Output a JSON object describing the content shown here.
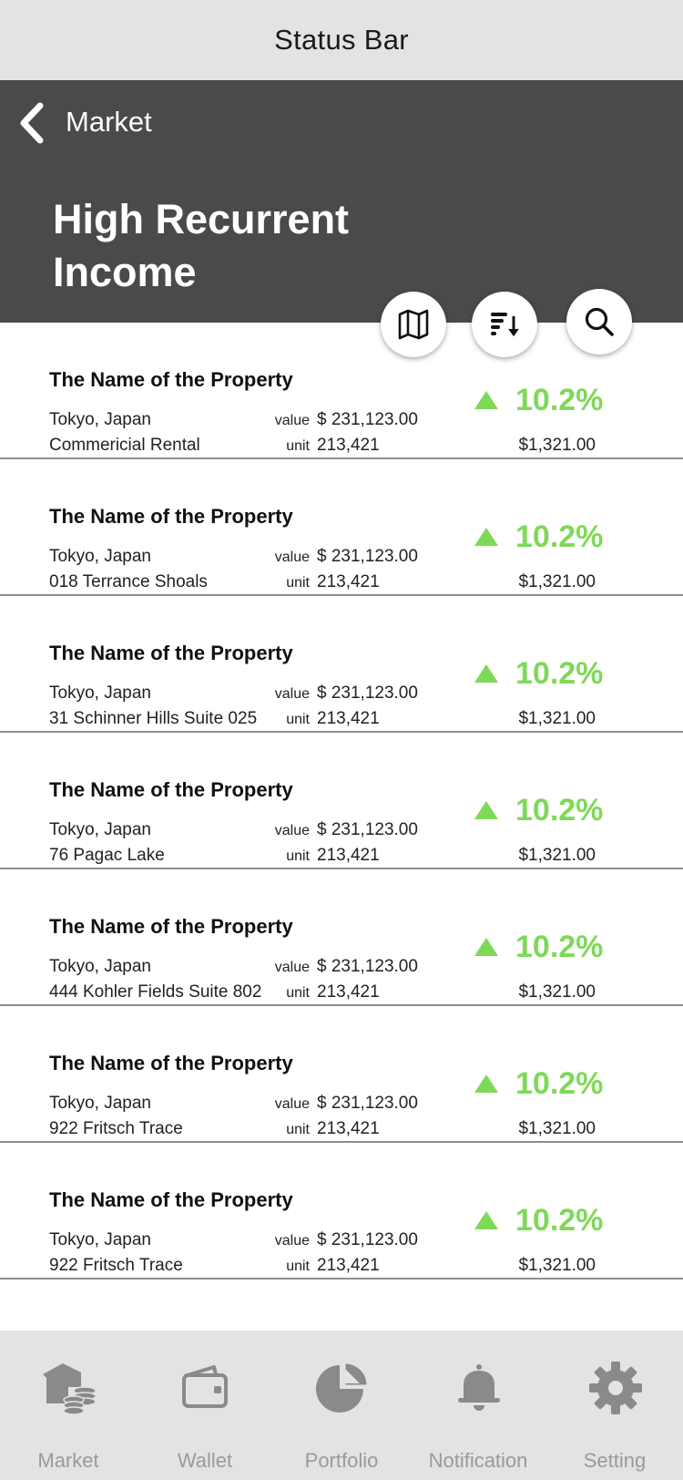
{
  "status_bar": {
    "text": "Status Bar"
  },
  "header": {
    "back_label": "Market",
    "title": "High Recurrent Income"
  },
  "actions": [
    {
      "name": "map",
      "icon": "map-icon"
    },
    {
      "name": "sort",
      "icon": "sort-descending-icon"
    },
    {
      "name": "search",
      "icon": "search-icon"
    }
  ],
  "colors": {
    "header_bg": "#4a4a4a",
    "positive": "#7ed957",
    "tabbar_bg": "#e3e2e5",
    "tab_icon": "#8a8a8a"
  },
  "list": {
    "value_label": "value",
    "unit_label": "unit",
    "items": [
      {
        "name": "The Name of the Property",
        "location": "Tokyo, Japan",
        "address": "Commericial Rental",
        "value": "$ 231,123.00",
        "unit": "213,421",
        "change": "10.2%",
        "price": "$1,321.00"
      },
      {
        "name": "The Name of the Property",
        "location": "Tokyo, Japan",
        "address": "018 Terrance Shoals",
        "value": "$ 231,123.00",
        "unit": "213,421",
        "change": "10.2%",
        "price": "$1,321.00"
      },
      {
        "name": "The Name of the Property",
        "location": "Tokyo, Japan",
        "address": "31 Schinner Hills Suite 025",
        "value": "$ 231,123.00",
        "unit": "213,421",
        "change": "10.2%",
        "price": "$1,321.00"
      },
      {
        "name": "The Name of the Property",
        "location": "Tokyo, Japan",
        "address": "76 Pagac Lake",
        "value": "$ 231,123.00",
        "unit": "213,421",
        "change": "10.2%",
        "price": "$1,321.00"
      },
      {
        "name": "The Name of the Property",
        "location": "Tokyo, Japan",
        "address": "444 Kohler Fields Suite 802",
        "value": "$ 231,123.00",
        "unit": "213,421",
        "change": "10.2%",
        "price": "$1,321.00"
      },
      {
        "name": "The Name of the Property",
        "location": "Tokyo, Japan",
        "address": "922 Fritsch Trace",
        "value": "$ 231,123.00",
        "unit": "213,421",
        "change": "10.2%",
        "price": "$1,321.00"
      },
      {
        "name": "The Name of the Property",
        "location": "Tokyo, Japan",
        "address": "922 Fritsch Trace",
        "value": "$ 231,123.00",
        "unit": "213,421",
        "change": "10.2%",
        "price": "$1,321.00"
      }
    ]
  },
  "tabbar": {
    "items": [
      {
        "label": "Market",
        "icon": "market-icon"
      },
      {
        "label": "Wallet",
        "icon": "wallet-icon"
      },
      {
        "label": "Portfolio",
        "icon": "portfolio-icon"
      },
      {
        "label": "Notification",
        "icon": "bell-icon"
      },
      {
        "label": "Setting",
        "icon": "gear-icon"
      }
    ]
  }
}
